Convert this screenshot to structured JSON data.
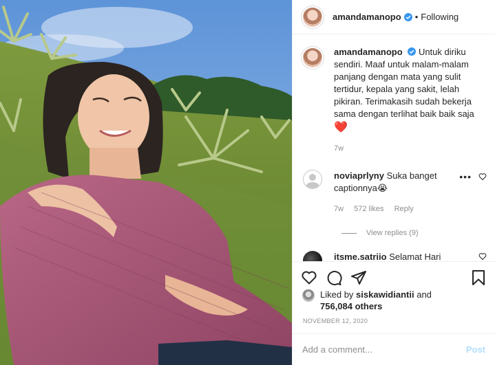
{
  "post": {
    "username": "amandamanopo",
    "follow_status": "Following",
    "separator": "•",
    "verified_icon": "verified-badge-icon"
  },
  "caption": {
    "username": "amandamanopo",
    "text": "Untuk diriku sendiri. Maaf untuk malam-malam panjang dengan mata yang sulit tertidur, kepala yang sakit, lelah pikiran. Terimakasih sudah bekerja sama dengan terlihat baik baik saja",
    "emoji": "❤️",
    "age": "7w"
  },
  "comments": [
    {
      "username": "noviaprlyny",
      "text": "Suka banget captionnya",
      "emoji": "😭",
      "age": "7w",
      "likes": "572 likes",
      "reply": "Reply",
      "view_replies": "View replies (9)"
    },
    {
      "username": "itsme.satriio",
      "text": "Selamat Hari Ayah untuk semua ayah di dunia."
    }
  ],
  "likes": {
    "prefix": "Liked by",
    "user": "siskawidiantii",
    "and": "and",
    "others": "756,084 others"
  },
  "date": "NOVEMBER 12, 2020",
  "add_comment": {
    "placeholder": "Add a comment...",
    "post_label": "Post"
  },
  "colors": {
    "accent": "#0095f6",
    "post_disabled": "#b2dffc",
    "heart": "#ed4956",
    "muted": "#8e8e8e"
  }
}
